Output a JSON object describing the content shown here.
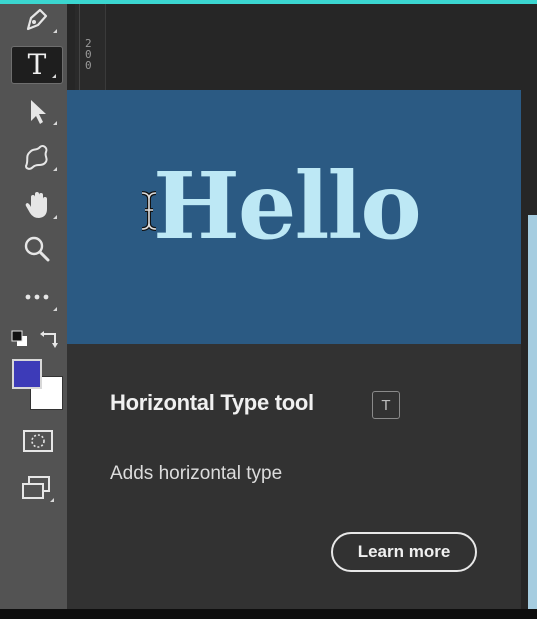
{
  "ruler": {
    "digits": "200"
  },
  "tools": [
    {
      "name": "pen-tool",
      "icon": "pen-icon"
    },
    {
      "name": "horizontal-type-tool",
      "icon": "type-icon",
      "label": "T",
      "active": true
    },
    {
      "name": "path-selection-tool",
      "icon": "arrow-icon"
    },
    {
      "name": "custom-shape-tool",
      "icon": "shape-icon"
    },
    {
      "name": "hand-tool",
      "icon": "hand-icon"
    },
    {
      "name": "zoom-tool",
      "icon": "magnifier-icon"
    },
    {
      "name": "edit-toolbar",
      "icon": "more-icon"
    }
  ],
  "colors": {
    "foreground": "#3d3bb8",
    "background": "#ffffff",
    "accent_line": "#3bd6d0"
  },
  "tooltip": {
    "preview_text": "Hello",
    "title": "Horizontal Type tool",
    "shortcut": "T",
    "description": "Adds horizontal type",
    "learn_more": "Learn more"
  }
}
